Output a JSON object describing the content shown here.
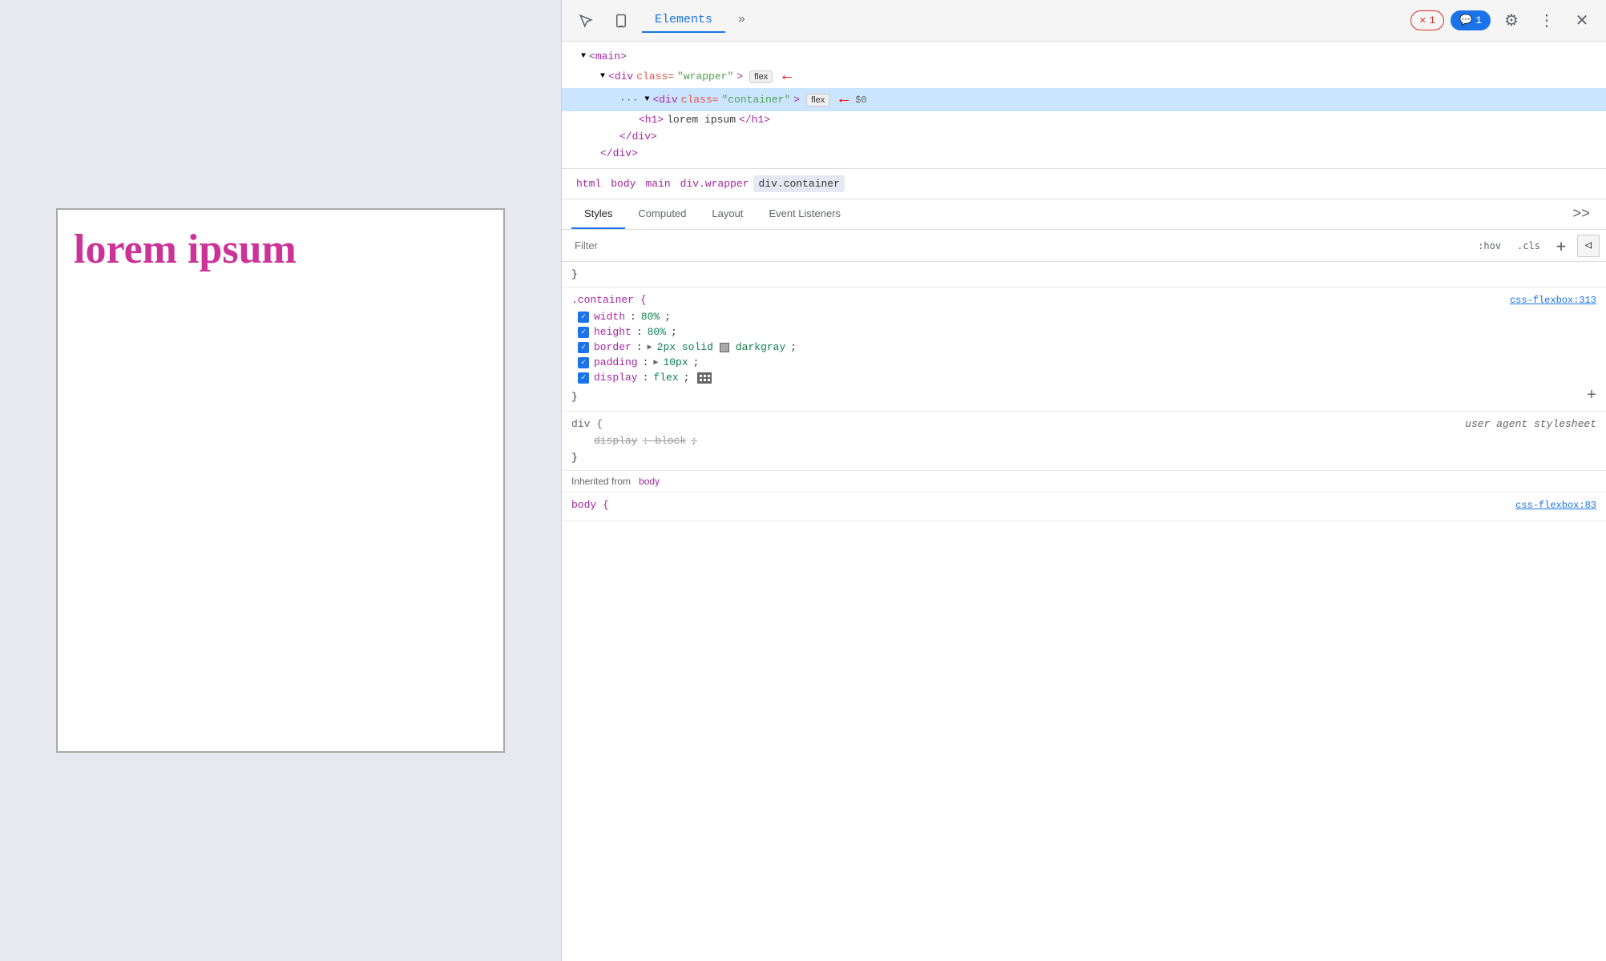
{
  "preview": {
    "text": "lorem ipsum"
  },
  "devtools": {
    "header": {
      "cursor_icon": "⬚",
      "device_icon": "▭",
      "elements_tab": "Elements",
      "more_tabs_icon": "»",
      "error_badge": "1",
      "message_badge": "1",
      "gear_icon": "⚙",
      "more_icon": "⋮",
      "close_icon": "✕"
    },
    "dom": {
      "lines": [
        {
          "indent": 1,
          "content": "<main>",
          "selected": false,
          "flex": false,
          "dots": false
        },
        {
          "indent": 2,
          "content": "<div class=\"wrapper\">",
          "selected": false,
          "flex": true,
          "dots": false,
          "arrow": true
        },
        {
          "indent": 3,
          "content": "<div class=\"container\">",
          "selected": true,
          "flex": true,
          "dots": true,
          "arrow": true
        },
        {
          "indent": 4,
          "content": "<h1>lorem ipsum</h1>",
          "selected": false,
          "flex": false,
          "dots": false
        },
        {
          "indent": 4,
          "content": "</div>",
          "selected": false,
          "flex": false,
          "dots": false
        },
        {
          "indent": 3,
          "content": "</div>",
          "selected": false,
          "flex": false,
          "dots": false
        }
      ]
    },
    "breadcrumb": {
      "items": [
        "html",
        "body",
        "main",
        "div.wrapper",
        "div.container"
      ]
    },
    "panel_tabs": {
      "tabs": [
        "Styles",
        "Computed",
        "Layout",
        "Event Listeners"
      ],
      "active": "Styles",
      "more": ">>"
    },
    "filter": {
      "placeholder": "Filter",
      "hov_btn": ":hov",
      "cls_btn": ".cls",
      "plus_btn": "+",
      "rtl_btn": "◁"
    },
    "styles": {
      "sections": [
        {
          "selector": ".container {",
          "source": "css-flexbox:313",
          "closing": "}",
          "props": [
            {
              "enabled": true,
              "name": "width",
              "value": "80%",
              "has_triangle": false
            },
            {
              "enabled": true,
              "name": "height",
              "value": "80%",
              "has_triangle": false
            },
            {
              "enabled": true,
              "name": "border",
              "value": "2px solid",
              "color": "darkgray",
              "has_triangle": true
            },
            {
              "enabled": true,
              "name": "padding",
              "value": "10px",
              "has_triangle": true
            },
            {
              "enabled": true,
              "name": "display",
              "value": "flex",
              "has_grid": true
            }
          ],
          "add_btn": "+"
        },
        {
          "selector": "div {",
          "source": "user agent stylesheet",
          "closing": "}",
          "ua": true,
          "props": [
            {
              "enabled": false,
              "name": "display",
              "value": "block",
              "strikethrough": true
            }
          ]
        }
      ],
      "inherited_label": "Inherited from",
      "inherited_element": "body",
      "inherited_source": "css-flexbox:83",
      "body_rule": "body {"
    }
  }
}
